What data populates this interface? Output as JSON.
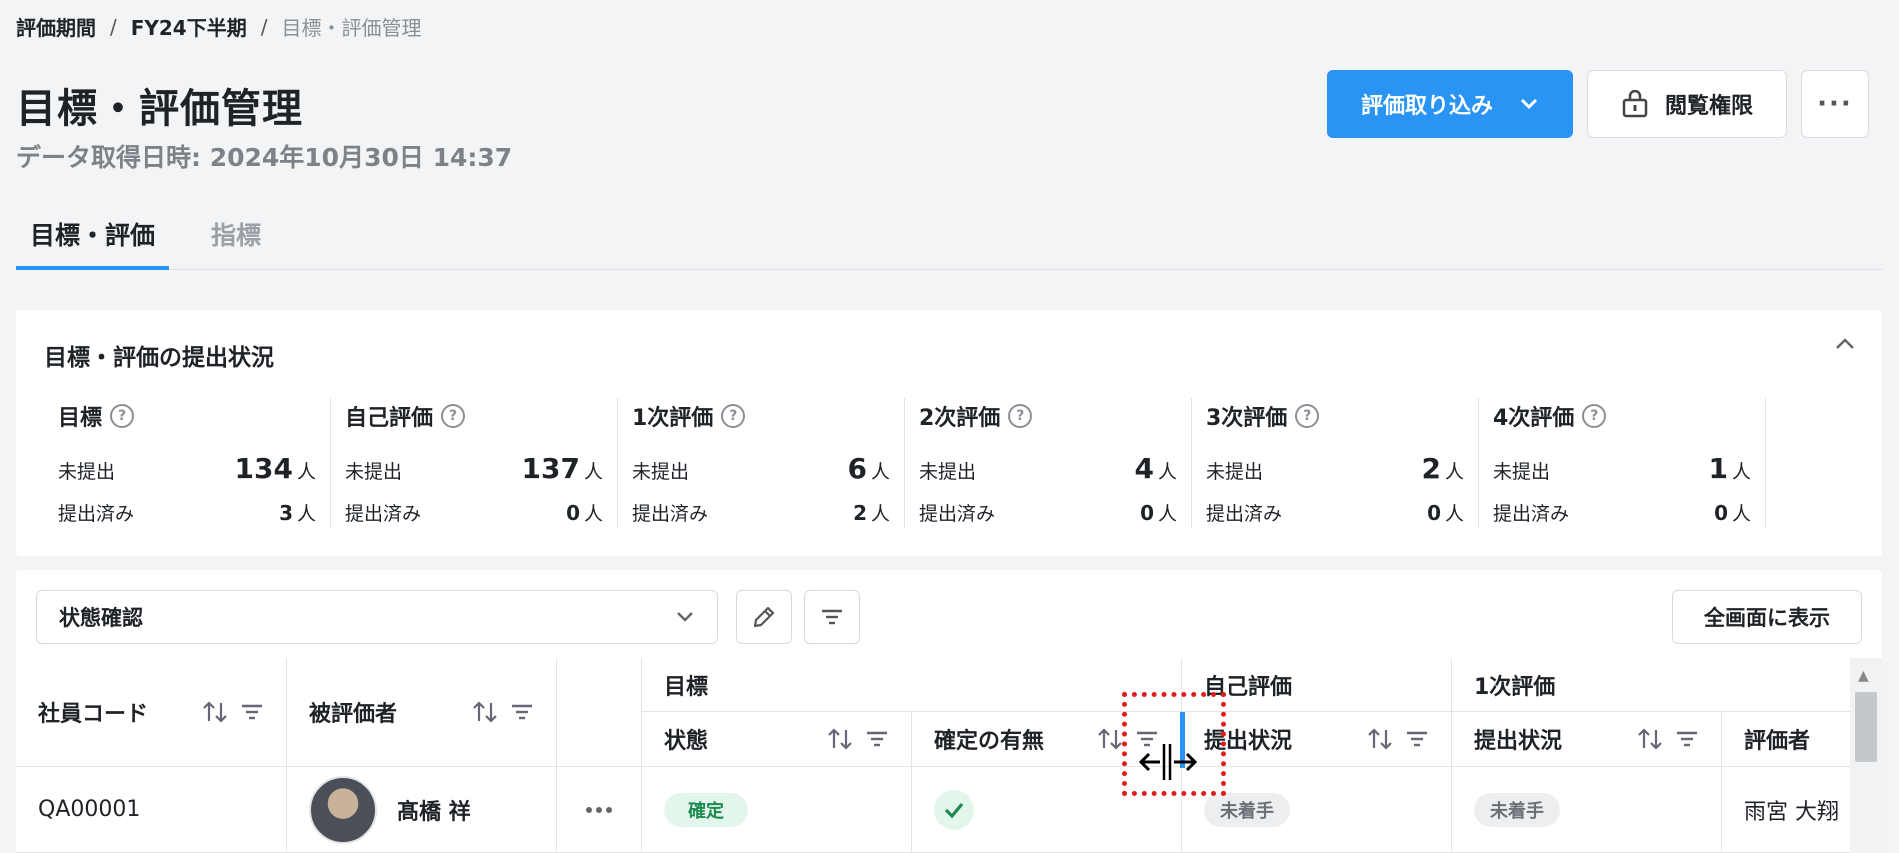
{
  "breadcrumb": {
    "item1": "評価期間",
    "item2": "FY24下半期",
    "item3": "目標・評価管理",
    "separator": "/"
  },
  "page": {
    "title": "目標・評価管理",
    "fetched": "データ取得日時: 2024年10月30日 14:37"
  },
  "actions": {
    "import_label": "評価取り込み",
    "access_label": "閲覧権限",
    "more_label": "···"
  },
  "tabs": {
    "goals": "目標・評価",
    "indicators": "指標"
  },
  "status_card": {
    "title": "目標・評価の提出状況",
    "metrics": [
      {
        "title": "目標",
        "unsubmitted_label": "未提出",
        "unsubmitted": "134",
        "submitted_label": "提出済み",
        "submitted": "3",
        "unit": "人"
      },
      {
        "title": "自己評価",
        "unsubmitted_label": "未提出",
        "unsubmitted": "137",
        "submitted_label": "提出済み",
        "submitted": "0",
        "unit": "人"
      },
      {
        "title": "1次評価",
        "unsubmitted_label": "未提出",
        "unsubmitted": "6",
        "submitted_label": "提出済み",
        "submitted": "2",
        "unit": "人"
      },
      {
        "title": "2次評価",
        "unsubmitted_label": "未提出",
        "unsubmitted": "4",
        "submitted_label": "提出済み",
        "submitted": "0",
        "unit": "人"
      },
      {
        "title": "3次評価",
        "unsubmitted_label": "未提出",
        "unsubmitted": "2",
        "submitted_label": "提出済み",
        "submitted": "0",
        "unit": "人"
      },
      {
        "title": "4次評価",
        "unsubmitted_label": "未提出",
        "unsubmitted": "1",
        "submitted_label": "提出済み",
        "submitted": "0",
        "unit": "人"
      }
    ]
  },
  "table": {
    "view_select": "状態確認",
    "fullscreen": "全画面に表示",
    "headers": {
      "employee_code": "社員コード",
      "evaluatee": "被評価者",
      "group_goals": "目標",
      "group_self": "自己評価",
      "group_first": "1次評価",
      "goal_status": "状態",
      "goal_confirmed": "確定の有無",
      "self_submission": "提出状況",
      "first_submission": "提出状況",
      "first_evaluator": "評価者"
    },
    "rows": [
      {
        "code": "QA00001",
        "name": "髙橋 祥",
        "goal_status": "確定",
        "self_submission": "未着手",
        "first_submission": "未着手",
        "first_evaluator": "雨宮 大翔"
      }
    ]
  },
  "colors": {
    "accent": "#2a94f4",
    "success": "#1e8a4f",
    "marker": "#e31b1b"
  }
}
